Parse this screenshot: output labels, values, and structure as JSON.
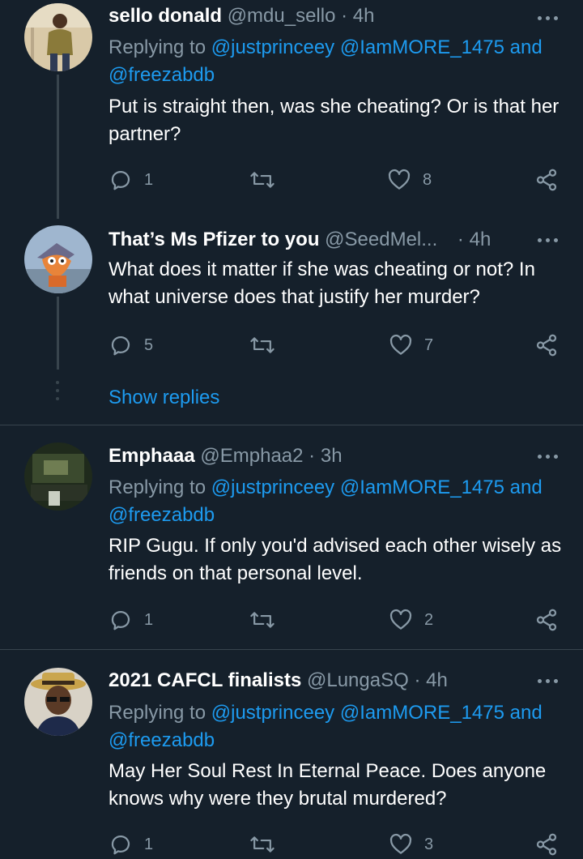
{
  "tweets": [
    {
      "name": "sello donald",
      "handle": "@mdu_sello",
      "time": "4h",
      "reply_prefix": "Replying to",
      "reply_line1": "@justprinceey @IamMORE_1475",
      "reply_and": "and",
      "reply_line2": "@freezabdb",
      "body": "Put is straight then, was she cheating? Or is that her partner?",
      "replies": "1",
      "retweets": "",
      "likes": "8"
    },
    {
      "name": "That’s Ms Pfizer to you",
      "handle": "@SeedMel...",
      "time": "4h",
      "body": "What does it matter if she was cheating or not? In what universe does that justify her murder?",
      "replies": "5",
      "retweets": "",
      "likes": "7",
      "show_replies": "Show replies"
    },
    {
      "name": "Emphaaa",
      "handle": "@Emphaa2",
      "time": "3h",
      "reply_prefix": "Replying to",
      "reply_line1": "@justprinceey @IamMORE_1475",
      "reply_and": "and",
      "reply_line2": "@freezabdb",
      "body": "RIP Gugu. If only you'd advised each other wisely as friends on that personal level.",
      "replies": "1",
      "retweets": "",
      "likes": "2"
    },
    {
      "name": "2021 CAFCL finalists",
      "handle": "@LungaSQ",
      "time": "4h",
      "reply_prefix": "Replying to",
      "reply_line1": "@justprinceey @IamMORE_1475",
      "reply_and": "and",
      "reply_line2": "@freezabdb",
      "body": "May Her Soul Rest In Eternal Peace. Does anyone knows why were they brutal murdered?",
      "replies": "1",
      "retweets": "",
      "likes": "3"
    }
  ],
  "separator": "·",
  "icons": {
    "reply": "reply-icon",
    "retweet": "retweet-icon",
    "like": "heart-icon",
    "share": "share-icon",
    "more": "more-icon"
  },
  "colors": {
    "background": "#15202b",
    "link": "#1d9bf0",
    "muted": "#8899a6",
    "divider": "#38444d"
  }
}
